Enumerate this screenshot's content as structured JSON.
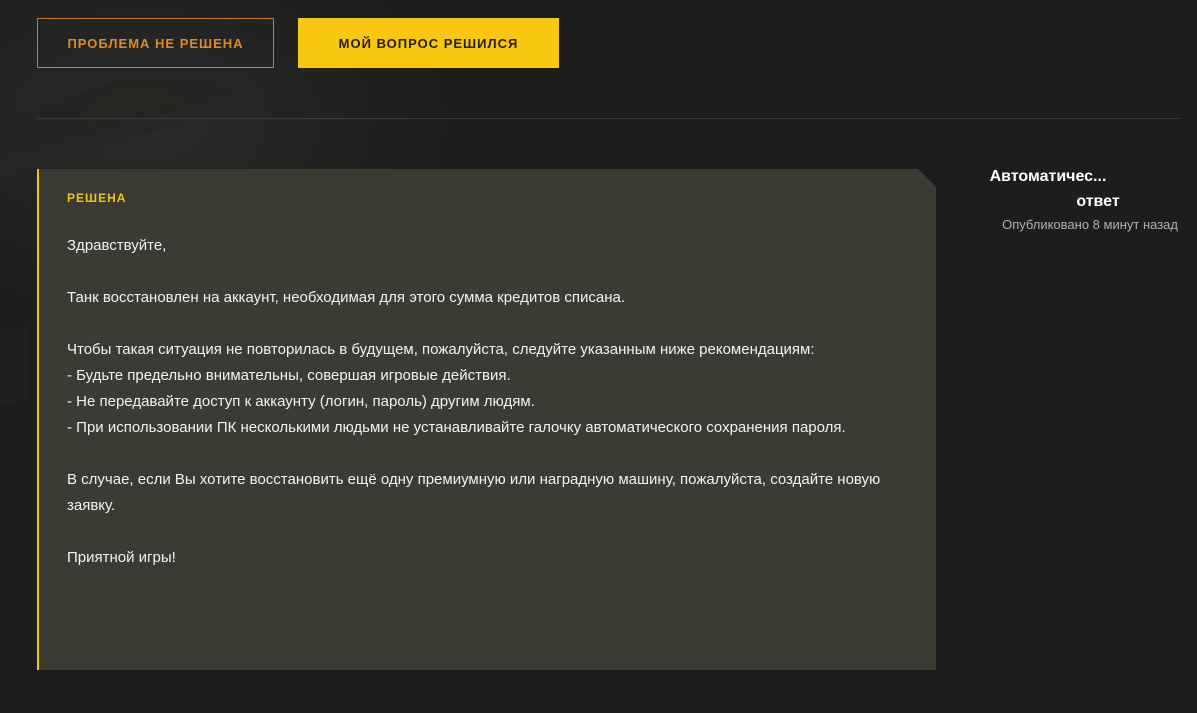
{
  "actions": {
    "unsolved_label": "ПРОБЛЕМА НЕ РЕШЕНА",
    "solved_label": "МОЙ ВОПРОС РЕШИЛСЯ"
  },
  "message": {
    "status": "РЕШЕНА",
    "paragraphs": [
      [
        "Здравствуйте,"
      ],
      [
        "Танк восстановлен на аккаунт, необходимая для этого сумма кредитов списана."
      ],
      [
        "Чтобы такая ситуация не повторилась в будущем, пожалуйста, следуйте указанным ниже рекомендациям:",
        "- Будьте предельно внимательны, совершая игровые действия.",
        "- Не передавайте доступ к аккаунту (логин, пароль) другим людям.",
        "- При использовании ПК несколькими людьми не устанавливайте галочку автоматического сохранения пароля."
      ],
      [
        "В случае, если Вы хотите восстановить ещё одну премиумную или наградную машину, пожалуйста, создайте новую заявку."
      ],
      [
        "Приятной игры!"
      ]
    ]
  },
  "author": {
    "name_line1": "Автоматичес...",
    "name_line2": "ответ",
    "published": "Опубликовано 8 минут назад"
  },
  "colors": {
    "accent_yellow": "#f9c70f",
    "accent_orange": "#e08a24",
    "card_bg": "#3b3a33",
    "page_bg": "#1d1d1d"
  }
}
